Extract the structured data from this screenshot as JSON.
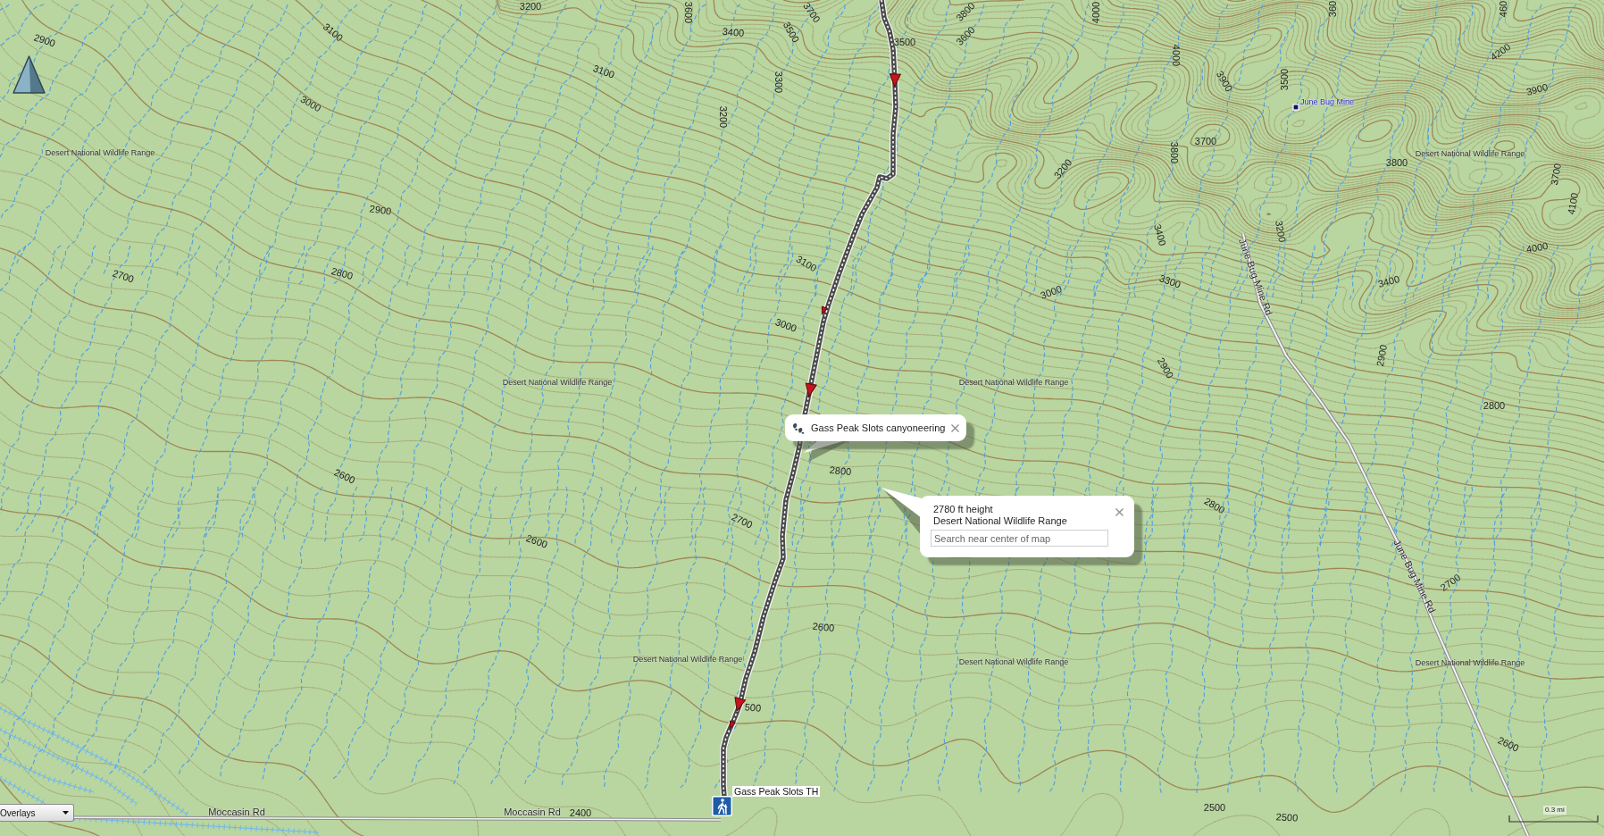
{
  "map": {
    "contour_labels": [
      "2900",
      "3100",
      "3200",
      "3600",
      "3400",
      "3700",
      "3500",
      "3800",
      "4000",
      "360",
      "460",
      "3500",
      "3600",
      "3100",
      "4000",
      "4200",
      "3300",
      "3500",
      "3900",
      "3900",
      "3000",
      "3200",
      "3700",
      "3800",
      "3800",
      "3200",
      "3700",
      "4100",
      "2900",
      "3200",
      "3400",
      "4000",
      "3100",
      "2800",
      "2700",
      "3300",
      "3400",
      "3000",
      "3000",
      "2900",
      "2900",
      "2800",
      "2800",
      "2600",
      "2800",
      "2700",
      "2600",
      "2700",
      "2600",
      "500",
      "2600",
      "2500",
      "2400",
      "2500"
    ],
    "area_labels": [
      "Desert National Wildlife Range",
      "Desert National Wildlife Range",
      "Desert National Wildlife Range",
      "Desert National Wildlife Range",
      "Desert National Wildlife Range",
      "Desert National Wildlife Range",
      "Desert National Wildlife Range"
    ],
    "road_labels": [
      "June Bug Mine Rd",
      "June Bug Mine Rd",
      "Moccasin Rd",
      "Moccasin Rd"
    ],
    "places": [
      {
        "name": "June Bug Mine"
      }
    ],
    "trailhead": {
      "name": "Gass Peak Slots TH"
    }
  },
  "route_popup": {
    "title": "Gass Peak Slots canyoneering"
  },
  "location_popup": {
    "elevation": "2780 ft height",
    "area": "Desert National Wildlife Range",
    "search": {
      "placeholder": "Search near center of map"
    }
  },
  "overlays": {
    "value": "Overlays"
  },
  "scale_bar": {
    "label": "0.3 mi"
  }
}
